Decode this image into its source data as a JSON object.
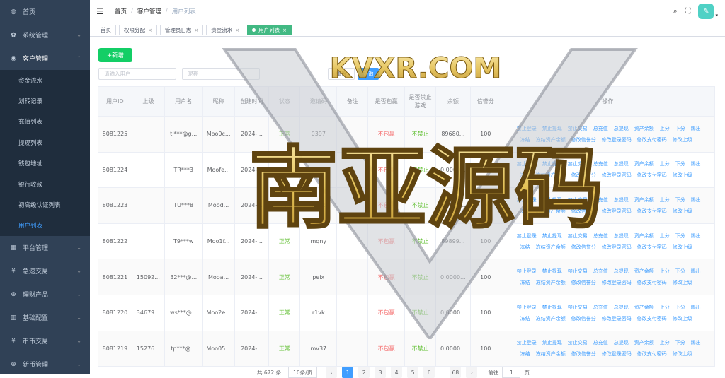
{
  "sidebar": {
    "items": [
      {
        "icon": "dashboard-icon",
        "glyph": "◍",
        "label": "首页",
        "chevron": ""
      },
      {
        "icon": "gear-icon",
        "glyph": "✿",
        "label": "系统管理",
        "chevron": "⌄"
      },
      {
        "icon": "user-group-icon",
        "glyph": "◉",
        "label": "客户管理",
        "chevron": "⌃"
      }
    ],
    "sub_items": [
      {
        "label": "资金流水"
      },
      {
        "label": "划转记录"
      },
      {
        "label": "充值列表"
      },
      {
        "label": "提现列表"
      },
      {
        "label": "钱包地址"
      },
      {
        "label": "银行收款"
      },
      {
        "label": "初高级认证列表"
      },
      {
        "label": "用户列表"
      }
    ],
    "items_after": [
      {
        "icon": "grid-icon",
        "glyph": "▦",
        "label": "平台管理",
        "chevron": "⌄"
      },
      {
        "icon": "yen-icon",
        "glyph": "¥",
        "label": "急速交易",
        "chevron": "⌄"
      },
      {
        "icon": "plus-circle-icon",
        "glyph": "⊕",
        "label": "理财产品",
        "chevron": "⌄"
      },
      {
        "icon": "book-icon",
        "glyph": "▥",
        "label": "基础配置",
        "chevron": "⌄"
      },
      {
        "icon": "yen-icon",
        "glyph": "¥",
        "label": "币币交易",
        "chevron": "⌄"
      },
      {
        "icon": "plus-circle-icon",
        "glyph": "⊕",
        "label": "新币管理",
        "chevron": "⌄"
      }
    ]
  },
  "navbar": {
    "hamburger": "☰",
    "breadcrumb": [
      "首页",
      "客户管理",
      "用户列表"
    ],
    "sep": "/",
    "search_glyph": "⌕",
    "fullscreen_glyph": "⛶",
    "avatar_glyph": "✎",
    "caret": "▾"
  },
  "tags": [
    {
      "label": "首页",
      "closable": false
    },
    {
      "label": "权限分配",
      "closable": true
    },
    {
      "label": "管理员日志",
      "closable": true
    },
    {
      "label": "资金流水",
      "closable": true
    },
    {
      "label": "用户列表",
      "closable": true,
      "active": true
    }
  ],
  "tag_close": "×",
  "toolbar": {
    "add_label": "+新增",
    "search_placeholder": "请输入用户",
    "field2_placeholder": "昵称",
    "reset_label": "重置",
    "query_label": "查询"
  },
  "table": {
    "headers": [
      "用户ID",
      "上级",
      "用户名",
      "昵称",
      "创建时间",
      "状态",
      "邀请码",
      "备注",
      "是否包赢",
      "是否禁止游戏",
      "余额",
      "信誉分",
      "操作"
    ],
    "rows": [
      {
        "id": "8081225",
        "parent": "",
        "username": "tl***@g...",
        "nick": "Moo0c...",
        "time": "2024-...",
        "status": "正常",
        "code": "0397",
        "note": "",
        "win": "不包赢",
        "ban": "不禁止",
        "balance": "89680...",
        "credit": "100"
      },
      {
        "id": "8081224",
        "parent": "",
        "username": "TR***3",
        "nick": "Moofe...",
        "time": "2024-...",
        "status": "正常",
        "code": "cm9c",
        "note": "",
        "win": "不包赢",
        "ban": "不禁止",
        "balance": "0.0000...",
        "credit": "100"
      },
      {
        "id": "8081223",
        "parent": "",
        "username": "TU***8",
        "nick": "Mood...",
        "time": "2024-...",
        "status": "正常",
        "code": "kvux",
        "note": "",
        "win": "不包赢",
        "ban": "不禁止",
        "balance": "0.0000...",
        "credit": "100"
      },
      {
        "id": "8081222",
        "parent": "",
        "username": "T9***w",
        "nick": "Moo1f...",
        "time": "2024-...",
        "status": "正常",
        "code": "mqny",
        "note": "",
        "win": "不包赢",
        "ban": "不禁止",
        "balance": "89899...",
        "credit": "100"
      },
      {
        "id": "8081221",
        "parent": "15092...",
        "username": "32***@...",
        "nick": "Mooa...",
        "time": "2024-...",
        "status": "正常",
        "code": "peix",
        "note": "",
        "win": "不包赢",
        "ban": "不禁止",
        "balance": "0.0000...",
        "credit": "100"
      },
      {
        "id": "8081220",
        "parent": "34679...",
        "username": "ws***@...",
        "nick": "Moo2e...",
        "time": "2024-...",
        "status": "正常",
        "code": "r1vk",
        "note": "",
        "win": "不包赢",
        "ban": "不禁止",
        "balance": "0.0000...",
        "credit": "100"
      },
      {
        "id": "8081219",
        "parent": "15276...",
        "username": "tp***@...",
        "nick": "Moo05...",
        "time": "2024-...",
        "status": "正常",
        "code": "mv37",
        "note": "",
        "win": "不包赢",
        "ban": "不禁止",
        "balance": "0.0000...",
        "credit": "100"
      }
    ],
    "ops_line1": [
      "禁止登录",
      "禁止提现",
      "禁止交易",
      "总充值",
      "总提现",
      "资产余额",
      "上分",
      "下分",
      "踢出"
    ],
    "ops_line2": [
      "冻结",
      "冻结资产余额",
      "修改信誉分",
      "修改登录密码",
      "修改支付密码",
      "修改上级"
    ]
  },
  "pager": {
    "total": "共 672 条",
    "page_size": "10条/页",
    "prev": "‹",
    "pages": [
      "1",
      "2",
      "3",
      "4",
      "5",
      "6"
    ],
    "ellipsis": "...",
    "last": "68",
    "next": "›",
    "goto": "前往",
    "goto_value": "1",
    "page_unit": "页"
  },
  "watermark": {
    "top": "KVXR.COM",
    "main": "南亚源码"
  },
  "colors": {
    "sidebar_bg": "#304156",
    "active": "#409eff",
    "green": "#67c23a",
    "red": "#f56c6c",
    "tag_active": "#42b983",
    "add_btn": "#13ce66"
  }
}
